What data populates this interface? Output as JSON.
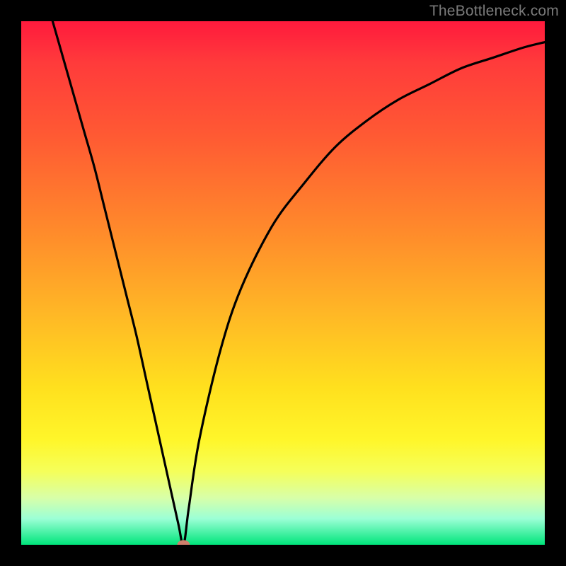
{
  "watermark": {
    "text": "TheBottleneck.com"
  },
  "chart_data": {
    "type": "line",
    "title": "",
    "xlabel": "",
    "ylabel": "",
    "xlim": [
      0,
      100
    ],
    "ylim": [
      0,
      100
    ],
    "grid": false,
    "legend": false,
    "background_gradient": {
      "direction": "vertical",
      "stops": [
        {
          "pos": 0,
          "color": "#ff1a3d"
        },
        {
          "pos": 22,
          "color": "#ff5a33"
        },
        {
          "pos": 55,
          "color": "#ffb526"
        },
        {
          "pos": 80,
          "color": "#fff62a"
        },
        {
          "pos": 95,
          "color": "#9cffd6"
        },
        {
          "pos": 100,
          "color": "#00e57b"
        }
      ]
    },
    "series": [
      {
        "name": "bottleneck-curve",
        "color": "#000000",
        "x": [
          6,
          8,
          10,
          12,
          14,
          16,
          18,
          20,
          22,
          24,
          26,
          28,
          30,
          31,
          32,
          34,
          38,
          42,
          48,
          54,
          60,
          66,
          72,
          78,
          84,
          90,
          96,
          100
        ],
        "y": [
          100,
          93,
          86,
          79,
          72,
          64,
          56,
          48,
          40,
          31,
          22,
          13,
          4,
          0,
          7,
          20,
          37,
          49,
          61,
          69,
          76,
          81,
          85,
          88,
          91,
          93,
          95,
          96
        ]
      }
    ],
    "marker": {
      "name": "optimal-point",
      "x": 31,
      "y": 0,
      "color": "#cf7f6c",
      "rx": 1.2,
      "ry": 0.9
    }
  }
}
